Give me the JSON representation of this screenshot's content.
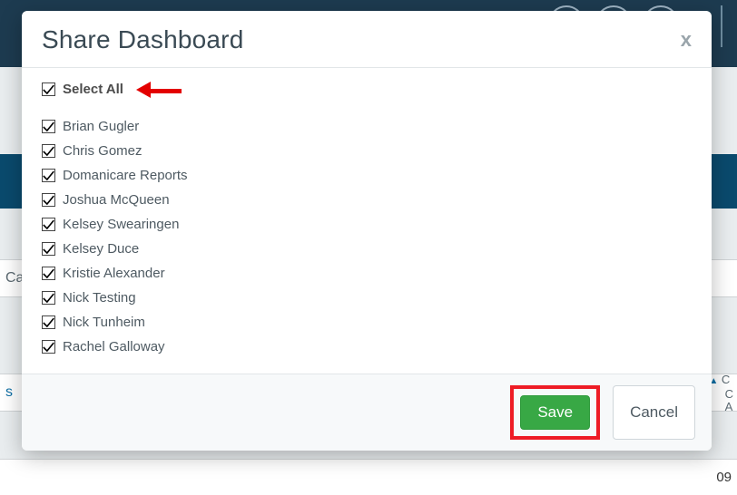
{
  "modal": {
    "title": "Share Dashboard",
    "close_label": "x",
    "select_all_label": "Select All",
    "select_all_checked": true,
    "users": [
      {
        "name": "Brian Gugler",
        "checked": true
      },
      {
        "name": "Chris Gomez",
        "checked": true
      },
      {
        "name": "Domanicare Reports",
        "checked": true
      },
      {
        "name": "Joshua McQueen",
        "checked": true
      },
      {
        "name": "Kelsey Swearingen",
        "checked": true
      },
      {
        "name": "Kelsey Duce",
        "checked": true
      },
      {
        "name": "Kristie Alexander",
        "checked": true
      },
      {
        "name": "Nick Testing",
        "checked": true
      },
      {
        "name": "Nick Tunheim",
        "checked": true
      },
      {
        "name": "Rachel Galloway",
        "checked": true
      }
    ],
    "save_label": "Save",
    "cancel_label": "Cancel"
  },
  "background": {
    "row1_text": "Cas",
    "row2_text": "s",
    "row3_rt": "09",
    "sort_hint": "▲"
  },
  "annotations": {
    "arrow_target": "select-all",
    "highlight_target": "save-button"
  }
}
